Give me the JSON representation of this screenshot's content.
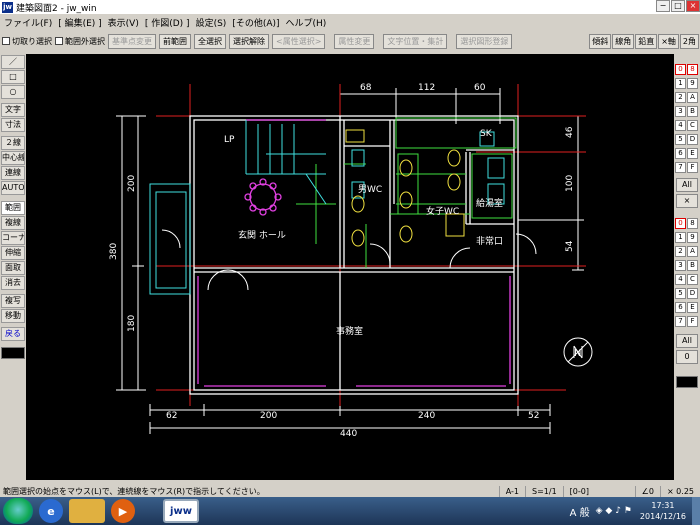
{
  "window": {
    "title": "建築図面2 - jw_win",
    "logo": "jw",
    "controls": [
      "−",
      "□",
      "×"
    ]
  },
  "menu": [
    "ファイル(F)",
    "[ 編集(E) ]",
    "表示(V)",
    "[ 作図(D) ]",
    "設定(S)",
    "[その他(A)]",
    "ヘルプ(H)"
  ],
  "toolbar": {
    "checkboxes": [
      "切取り選択",
      "範囲外選択"
    ],
    "buttons": [
      {
        "label": "基準点変更",
        "enabled": false
      },
      {
        "label": "前範囲",
        "enabled": true
      },
      {
        "label": "全選択",
        "enabled": true
      },
      {
        "label": "選択解除",
        "enabled": true
      },
      {
        "label": "<属性選択>",
        "enabled": false
      },
      {
        "label": "属性変更",
        "enabled": false
      },
      {
        "label": "文字位置・集計",
        "enabled": false
      },
      {
        "label": "選択図形登録",
        "enabled": false
      }
    ],
    "right_buttons": [
      "線角",
      "鉛直",
      "×軸",
      "2角"
    ],
    "highlight_button": "傾斜"
  },
  "left_tools": [
    "／",
    "□",
    "○",
    "文字",
    "寸法",
    "２線",
    "中心線",
    "連線",
    "AUTO",
    "範囲",
    "複線",
    "コーナー",
    "伸縮",
    "面取",
    "消去",
    "複写",
    "移動",
    "戻る"
  ],
  "right_panel": {
    "layer_group_top": [
      "0",
      "1",
      "2",
      "3",
      "4",
      "5",
      "6",
      "7",
      "8",
      "9",
      "A",
      "B",
      "C",
      "D",
      "E",
      "F"
    ],
    "all_label": "All",
    "close_label": "×",
    "layer_group_bottom_left": [
      "0",
      "1",
      "2",
      "3",
      "4",
      "5",
      "6",
      "7"
    ],
    "layer_group_bottom_right": [
      "8",
      "9",
      "A",
      "B",
      "C",
      "D",
      "E",
      "F"
    ],
    "all_label_2": "All",
    "zero_label": "0"
  },
  "drawing": {
    "dims_top": [
      "68",
      "112",
      "60"
    ],
    "dims_bottom": [
      "62",
      "200",
      "240",
      "52"
    ],
    "dim_total_bottom": "440",
    "dims_left": [
      "200",
      "180"
    ],
    "dim_total_left": "380",
    "dims_right": [
      "46",
      "100",
      "54"
    ],
    "rooms": {
      "lp": "LP",
      "entrance": "玄関 ホール",
      "mens_wc": "男WC",
      "womens_wc": "女子WC",
      "sk": "SK",
      "kitchen": "給湯室",
      "emergency": "非常口",
      "office": "事務室"
    },
    "north": "N"
  },
  "status": {
    "message": "範囲選択の始点をマウス(L)で、連続線をマウス(R)で指示してください。",
    "paper": "A-1",
    "scale": "S=1/1",
    "layer": "[0-0]",
    "angle": "∠0",
    "zoom": "× 0.25"
  },
  "taskbar": {
    "ime": "A 般",
    "time": "17:31",
    "date": "2014/12/16",
    "app_label": "jww"
  }
}
